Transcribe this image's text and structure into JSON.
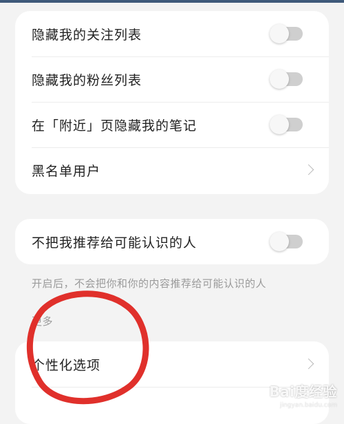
{
  "privacy": {
    "hide_following": {
      "label": "隐藏我的关注列表",
      "enabled": false
    },
    "hide_followers": {
      "label": "隐藏我的粉丝列表",
      "enabled": false
    },
    "hide_nearby_notes": {
      "label": "在「附近」页隐藏我的笔记",
      "enabled": false
    },
    "blacklist": {
      "label": "黑名单用户"
    }
  },
  "recommend": {
    "no_recommend": {
      "label": "不把我推荐给可能认识的人",
      "enabled": false
    },
    "hint": "开启后，不会把你和你的内容推荐给可能认识的人"
  },
  "more": {
    "title": "更多",
    "personalization": {
      "label": "个性化选项"
    }
  },
  "annotation": {
    "color": "#e0302b"
  },
  "watermark": {
    "text": "Bai度经验",
    "sub": "jingyan.baidu.com"
  },
  "colors": {
    "toggle_off": "#cfcfcf",
    "background": "#f3f3f3",
    "card": "#ffffff"
  }
}
